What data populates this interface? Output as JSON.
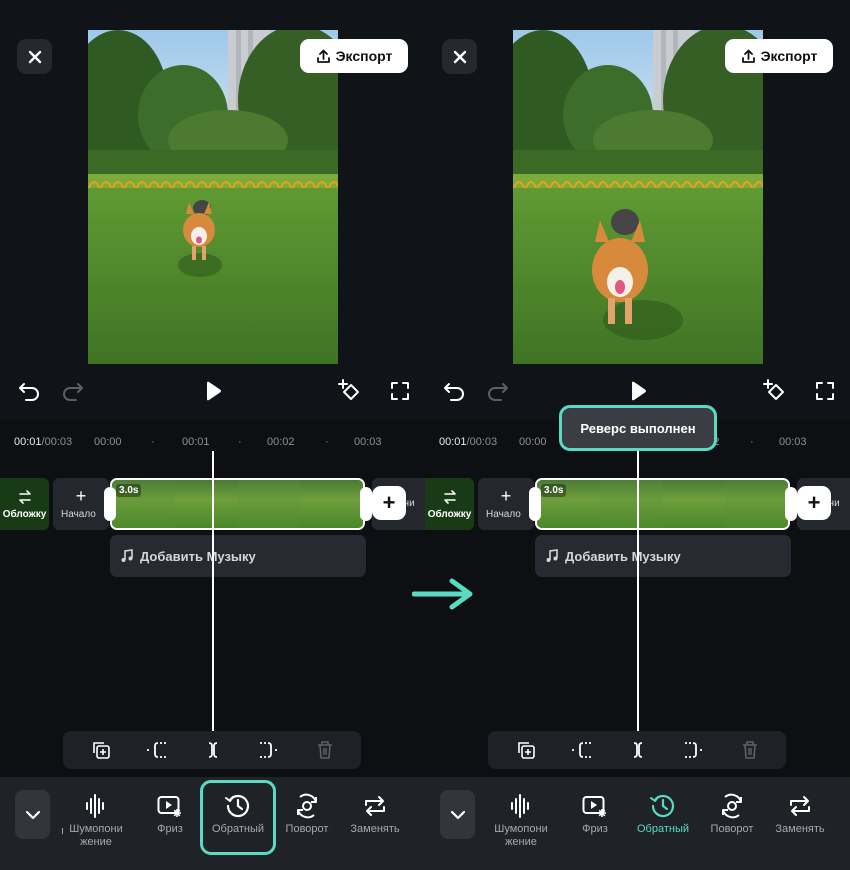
{
  "header": {
    "export_label": "Экспорт"
  },
  "timeline": {
    "current_time": "00:01",
    "total_time": "00:03",
    "ticks": [
      "00:00",
      "00:01",
      "00:02",
      "00:03"
    ],
    "tick_separator": "/",
    "cover_label": "Обложку",
    "start_label": "Начало",
    "end_label_fragment": "e",
    "end_label_fragment_left": "ани",
    "clip_duration": "3.0s",
    "add_music_label": "Добавить Музыку"
  },
  "toolbar": {
    "tools_left": [
      {
        "label": "Шумопони жение",
        "icon": "noise-waveform-icon"
      },
      {
        "label": "Фриз",
        "icon": "freeze-frame-icon"
      },
      {
        "label": "Обратный",
        "icon": "reverse-clock-icon"
      },
      {
        "label": "Поворот",
        "icon": "rotate-icon"
      },
      {
        "label": "Заменять",
        "icon": "replace-icon"
      }
    ],
    "fragment": "ı"
  },
  "toast": {
    "message": "Реверс выполнен"
  },
  "colors": {
    "accent": "#58dbc2",
    "background": "#101318",
    "toolbar": "#1f2227"
  }
}
